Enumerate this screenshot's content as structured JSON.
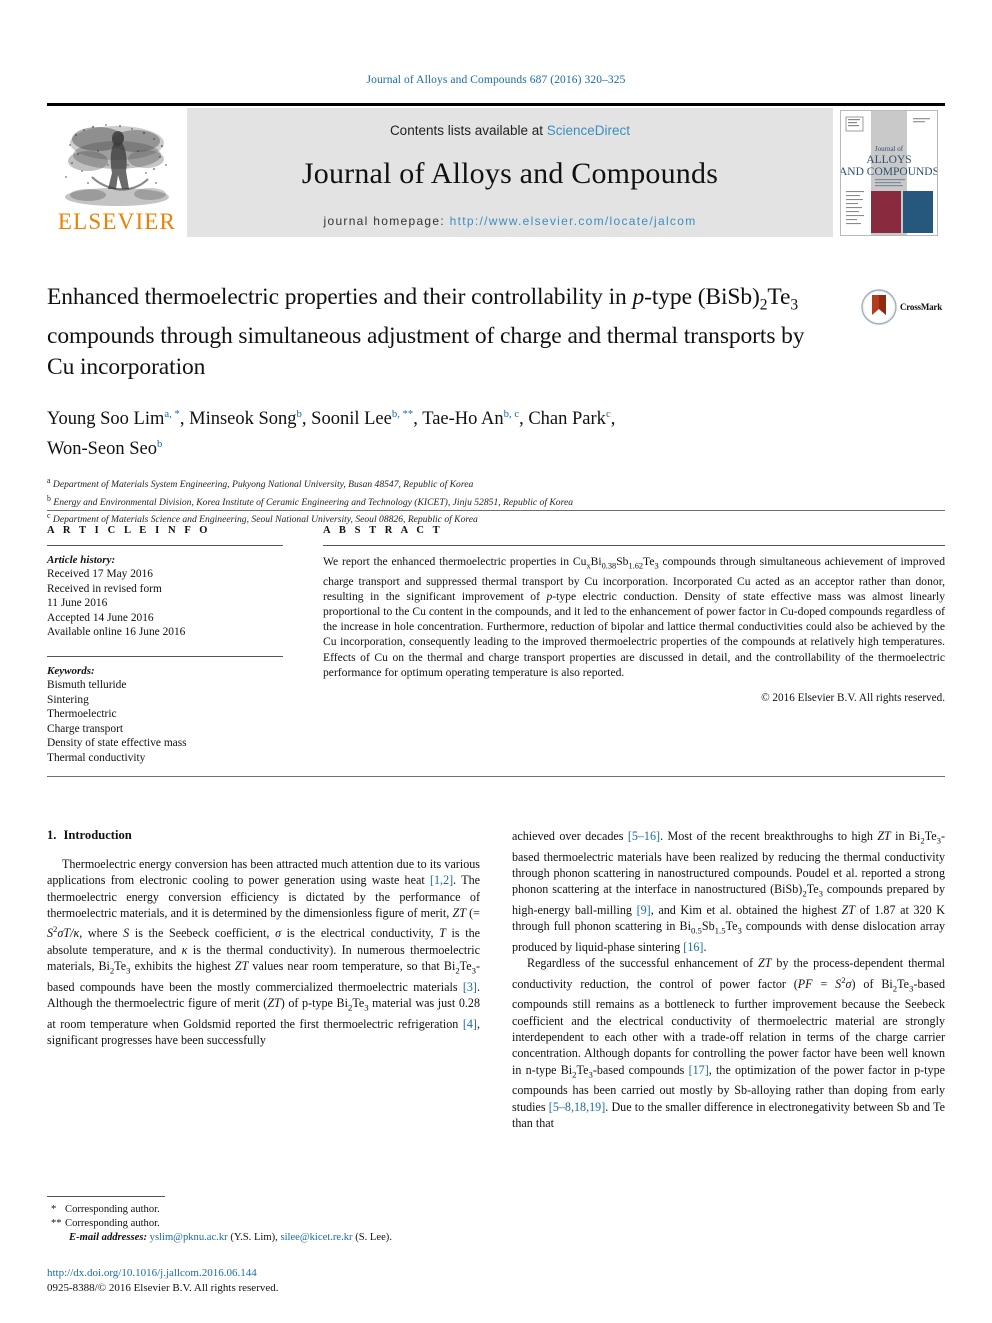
{
  "running_head": "Journal of Alloys and Compounds 687 (2016) 320–325",
  "masthead": {
    "publisher_name": "ELSEVIER",
    "contents_prefix": "Contents lists available at ",
    "contents_link": "ScienceDirect",
    "journal_title": "Journal of Alloys and Compounds",
    "homepage_prefix": "journal homepage: ",
    "homepage_url": "http://www.elsevier.com/locate/jalcom",
    "cover": {
      "line1": "Journal of",
      "line2": "ALLOYS",
      "line3": "AND COMPOUNDS"
    }
  },
  "crossmark": {
    "label": "CrossMark"
  },
  "title": {
    "line1_a": "Enhanced thermoelectric properties and their controllability in ",
    "line1_italic": "p",
    "line1_b": "-type",
    "line2_a": "(BiSb)",
    "line2_sub1": "2",
    "line2_b": "Te",
    "line2_sub2": "3",
    "line2_c": " compounds through simultaneous adjustment of charge",
    "line3": "and thermal transports by Cu incorporation"
  },
  "authors": [
    {
      "name": "Young Soo Lim",
      "marks": "a, *",
      "sep": ", "
    },
    {
      "name": "Minseok Song",
      "marks": "b",
      "sep": ", "
    },
    {
      "name": "Soonil Lee",
      "marks": "b, **",
      "sep": ", "
    },
    {
      "name": "Tae-Ho An",
      "marks": "b, c",
      "sep": ", "
    },
    {
      "name": "Chan Park",
      "marks": "c",
      "sep": ","
    },
    {
      "name": "Won-Seon Seo",
      "marks": "b",
      "sep": ""
    }
  ],
  "affiliations": [
    {
      "mark": "a",
      "text": "Department of Materials System Engineering, Pukyong National University, Busan 48547, Republic of Korea"
    },
    {
      "mark": "b",
      "text": "Energy and Environmental Division, Korea Institute of Ceramic Engineering and Technology (KICET), Jinju 52851, Republic of Korea"
    },
    {
      "mark": "c",
      "text": "Department of Materials Science and Engineering, Seoul National University, Seoul 08826, Republic of Korea"
    }
  ],
  "article_info": {
    "heading": "A R T I C L E   I N F O",
    "history_label": "Article history:",
    "history": [
      "Received 17 May 2016",
      "Received in revised form",
      "11 June 2016",
      "Accepted 14 June 2016",
      "Available online 16 June 2016"
    ],
    "keywords_label": "Keywords:",
    "keywords": [
      "Bismuth telluride",
      "Sintering",
      "Thermoelectric",
      "Charge transport",
      "Density of state effective mass",
      "Thermal conductivity"
    ]
  },
  "abstract": {
    "heading": "A B S T R A C T",
    "part1": "We report the enhanced thermoelectric properties in Cu",
    "sub_x": "x",
    "part2": "Bi",
    "sub_038": "0.38",
    "part3": "Sb",
    "sub_162": "1.62",
    "part4": "Te",
    "sub_3": "3",
    "part5": " compounds through simultaneous achievement of improved charge transport and suppressed thermal transport by Cu incorporation. Incorporated Cu acted as an acceptor rather than donor, resulting in the significant improvement of ",
    "italic_p": "p",
    "part6": "-type electric conduction. Density of state effective mass was almost linearly proportional to the Cu content in the compounds, and it led to the enhancement of power factor in Cu-doped compounds regardless of the increase in hole concentration. Furthermore, reduction of bipolar and lattice thermal conductivities could also be achieved by the Cu incorporation, consequently leading to the improved thermoelectric properties of the compounds at relatively high temperatures. Effects of Cu on the thermal and charge transport properties are discussed in detail, and the controllability of the thermoelectric performance for optimum operating temperature is also reported.",
    "copyright": "© 2016 Elsevier B.V. All rights reserved."
  },
  "introduction": {
    "number": "1.",
    "heading": "Introduction",
    "left_p1_a": "Thermoelectric energy conversion has been attracted much attention due to its various applications from electronic cooling to power generation using waste heat ",
    "left_ref_12": "[1,2]",
    "left_p1_b": ". The thermoelectric energy conversion efficiency is dictated by the performance of thermoelectric materials, and it is determined by the dimensionless figure of merit, ",
    "left_zt": "ZT",
    "left_p1_c": " (= ",
    "left_s": "S",
    "left_sup2": "2",
    "left_sigma": "σT/κ",
    "left_p1_d": ", where ",
    "left_s2": "S",
    "left_p1_e": " is the Seebeck coefficient, ",
    "left_sigma2": "σ",
    "left_p1_f": " is the electrical conductivity, ",
    "left_t": "T",
    "left_p1_g": " is the absolute temperature, and ",
    "left_kappa": "κ",
    "left_p1_h": " is the thermal conductivity). In numerous thermoelectric materials, Bi",
    "left_sub2": "2",
    "left_p1_i": "Te",
    "left_sub3": "3",
    "left_p1_j": " exhibits the highest ",
    "left_zt2": "ZT",
    "left_p1_k": " values near room temperature, so that Bi",
    "left_p1_l": "Te",
    "left_p1_m": "-based compounds have been the mostly commercialized thermoelectric materials ",
    "left_ref_3": "[3]",
    "left_p1_n": ". Although the thermoelectric figure of merit (",
    "left_zt3": "ZT",
    "left_p1_o": ") of p-type Bi",
    "left_p1_p": "Te",
    "left_p1_q": " material was just 0.28 at room temperature when Goldsmid reported the first thermoelectric refrigeration ",
    "left_ref_4": "[4]",
    "left_p1_r": ", significant progresses have been successfully",
    "right_p1_a": "achieved over decades ",
    "right_ref_516": "[5–16]",
    "right_p1_b": ". Most of the recent breakthroughs to high ",
    "right_zt": "ZT",
    "right_p1_c": " in Bi",
    "right_p1_d": "Te",
    "right_p1_e": "-based thermoelectric materials have been realized by reducing the thermal conductivity through phonon scattering in nanostructured compounds. Poudel et al. reported a strong phonon scattering at the interface in nanostructured (BiSb)",
    "right_p1_f": "Te",
    "right_p1_g": " compounds prepared by high-energy ball-milling ",
    "right_ref_9": "[9]",
    "right_p1_h": ", and Kim et al. obtained the highest ",
    "right_zt2": "ZT",
    "right_p1_i": " of 1.87 at 320 K through full phonon scattering in Bi",
    "right_sub05": "0.5",
    "right_p1_j": "Sb",
    "right_sub15": "1.5",
    "right_p1_k": "Te",
    "right_p1_l": " compounds with dense dislocation array produced by liquid-phase sintering ",
    "right_ref_16": "[16]",
    "right_p1_m": ".",
    "right_p2_a": "Regardless of the successful enhancement of ",
    "right_zt3": "ZT",
    "right_p2_b": " by the process-dependent thermal conductivity reduction, the control of power factor (",
    "right_pf": "PF",
    "right_p2_c": " = ",
    "right_s": "S",
    "right_sup2": "2",
    "right_sigma": "σ",
    "right_p2_d": ") of Bi",
    "right_p2_e": "Te",
    "right_p2_f": "-based compounds still remains as a bottleneck to further improvement because the Seebeck coefficient and the electrical conductivity of thermoelectric material are strongly interdependent to each other with a trade-off relation in terms of the charge carrier concentration. Although dopants for controlling the power factor have been well known in n-type Bi",
    "right_p2_g": "Te",
    "right_p2_h": "-based compounds ",
    "right_ref_17": "[17]",
    "right_p2_i": ", the optimization of the power factor in p-type compounds has been carried out mostly by Sb-alloying rather than doping from early studies ",
    "right_ref_581819": "[5–8,18,19]",
    "right_p2_j": ". Due to the smaller difference in electronegativity between Sb and Te than that"
  },
  "footnotes": {
    "corr1_marker": "*",
    "corr1_text": "Corresponding author.",
    "corr2_marker": "**",
    "corr2_text": "Corresponding author.",
    "email_label": "E-mail addresses:",
    "email1": "yslim@pknu.ac.kr",
    "email1_who": "(Y.S. Lim),",
    "email2": "silee@kicet.re.kr",
    "email2_who": "(S. Lee)."
  },
  "doi": {
    "url": "http://dx.doi.org/10.1016/j.jallcom.2016.06.144",
    "issn_line": "0925-8388/© 2016 Elsevier B.V. All rights reserved."
  },
  "colors": {
    "link_blue": "#1a6ba8",
    "sciencedirect_blue": "#3a8fbf",
    "elsevier_orange": "#EE8000",
    "band_gray": "#e3e3e3",
    "cover_maroon": "#8a2a3f",
    "cover_navy": "#26577c"
  }
}
